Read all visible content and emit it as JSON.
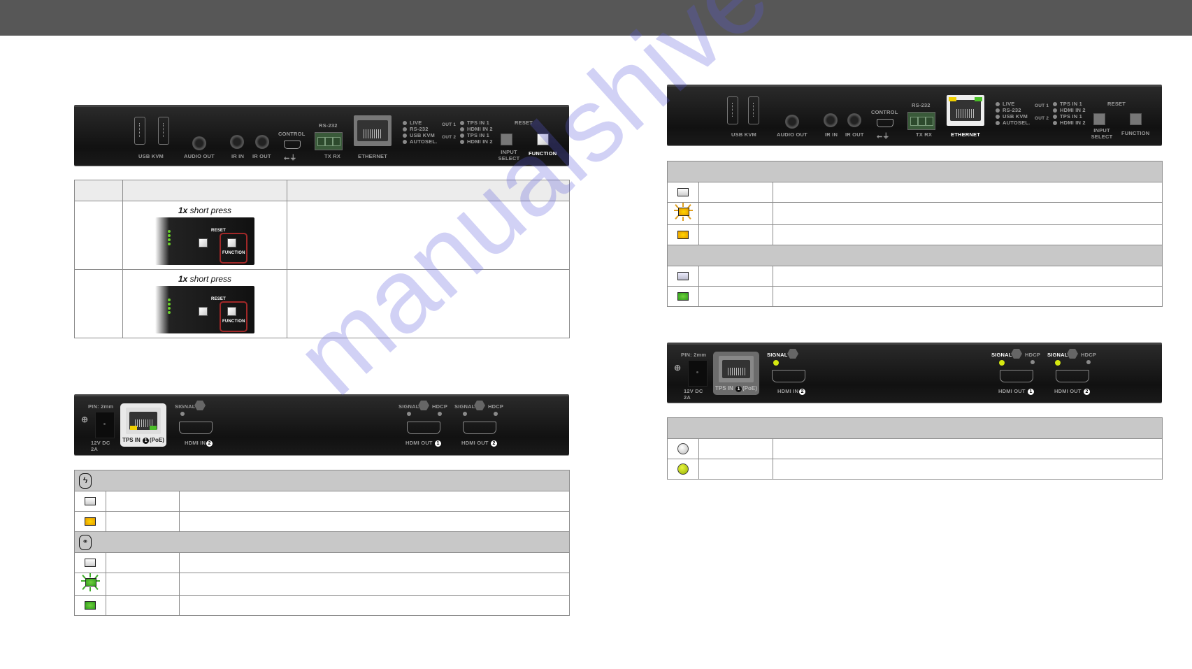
{
  "watermark": "manualshive.com",
  "panel_front": {
    "usb_kvm": "USB KVM",
    "audio_out": "AUDIO OUT",
    "ir_in": "IR IN",
    "ir_out": "IR OUT",
    "control": "CONTROL",
    "rs232": "RS-232",
    "tx_rx": "TX RX",
    "ethernet": "ETHERNET",
    "status_leds": [
      "LIVE",
      "RS-232",
      "USB KVM",
      "AUTOSEL."
    ],
    "out1": "OUT 1",
    "out2": "OUT 2",
    "out_leds": [
      "TPS IN 1",
      "HDMI IN 2",
      "TPS IN 1",
      "HDMI IN 2"
    ],
    "reset": "RESET",
    "input_select": "INPUT SELECT",
    "function": "FUNCTION"
  },
  "press_table": {
    "rows": [
      {
        "press_label_bold": "1x",
        "press_label": " short press"
      },
      {
        "press_label_bold": "1x",
        "press_label": " short press"
      }
    ]
  },
  "panel_rear": {
    "pin": "PIN: 2mm",
    "power": "12V DC",
    "power_amps": "2A",
    "tps_in": "TPS IN",
    "tps_in_num": "1",
    "poe": "(PoE)",
    "signal": "SIGNAL",
    "hdcp": "HDCP",
    "hdmi_in": "HDMI IN",
    "hdmi_in_num": "2",
    "hdmi_out": "HDMI OUT",
    "hdmi_out1_num": "1",
    "hdmi_out2_num": "2"
  },
  "led_tables": {
    "tps_left": {
      "sections": [
        {
          "icon": "power-bolt-icon",
          "glyph": "ϟ",
          "rows": [
            "off",
            "orange"
          ]
        },
        {
          "icon": "link-icon",
          "glyph": "🔗",
          "rows": [
            "off",
            "green-blinking",
            "green"
          ]
        }
      ]
    },
    "ethernet_right": {
      "sections": [
        {
          "rows": [
            "off",
            "orange-blinking",
            "orange"
          ]
        },
        {
          "rows": [
            "off",
            "green"
          ]
        }
      ]
    },
    "signal_right": {
      "rows": [
        "off",
        "lime"
      ]
    }
  },
  "colors": {
    "topbar": "#575757",
    "table_header": "#c8c8c8",
    "led_orange": "#f0b000",
    "led_green": "#4cb82a",
    "led_lime": "#c8e000",
    "function_highlight": "#a02828"
  }
}
